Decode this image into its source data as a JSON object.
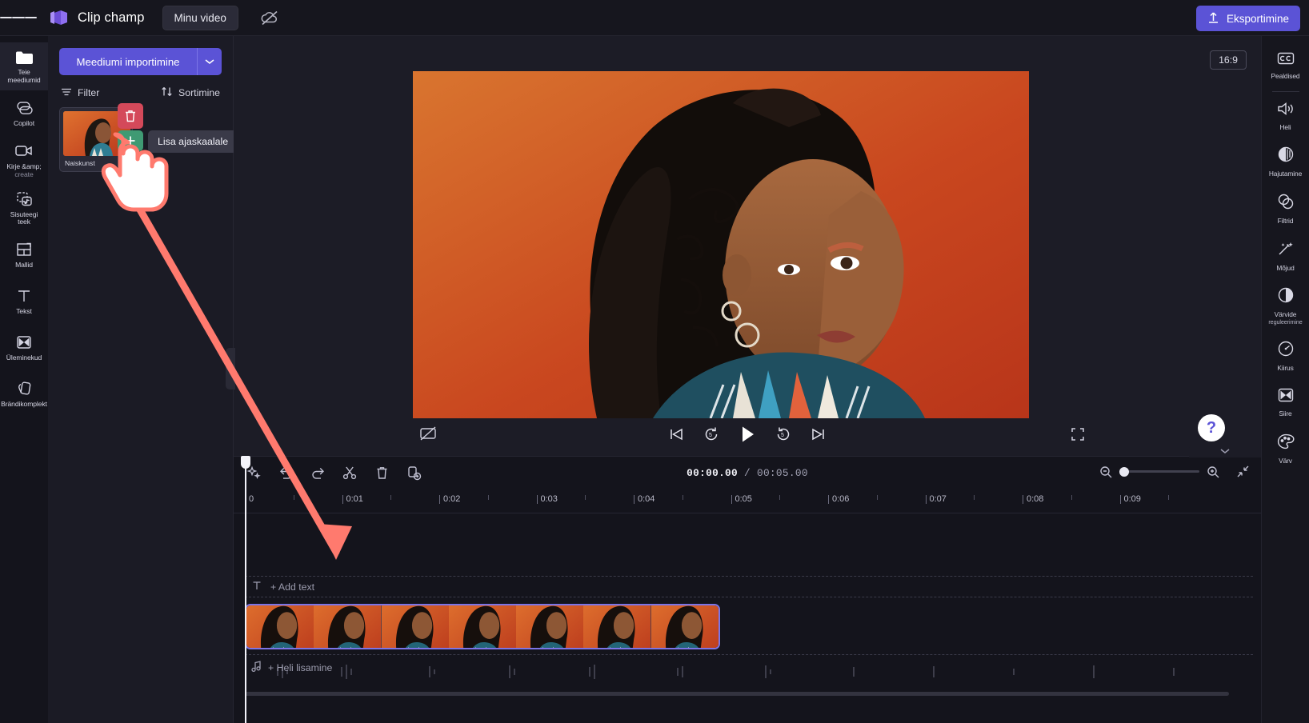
{
  "app": {
    "brand": "Clip champ",
    "project_button": "Minu video",
    "export_button": "Eksportimine",
    "cloud_icon": "cloud-off-icon",
    "menu_icon": "hamburger-icon"
  },
  "left_rail": {
    "items": [
      {
        "label": "Teie meediumid",
        "icon": "folder-icon",
        "active": true
      },
      {
        "label": "Copilot",
        "icon": "copilot-icon",
        "active": false
      },
      {
        "label": "Kirje &amp;",
        "label2": "create",
        "icon": "camera-icon",
        "active": false
      },
      {
        "label": "Sisuteegi",
        "label2": "teek",
        "icon": "content-library-icon",
        "active": false
      },
      {
        "label": "Mallid",
        "icon": "templates-icon",
        "active": false
      },
      {
        "label": "Tekst",
        "icon": "text-icon",
        "active": false
      },
      {
        "label": "Üleminekud",
        "icon": "transitions-icon",
        "active": false
      },
      {
        "label": "Brändikomplekt",
        "icon": "brand-kit-icon",
        "active": false
      }
    ]
  },
  "media_panel": {
    "import_button": "Meediumi importimine",
    "import_caret_icon": "chevron-down-icon",
    "filter_label": "Filter",
    "filter_icon": "filter-icon",
    "sort_label": "Sortimine",
    "sort_icon": "sort-arrows-icon",
    "items": [
      {
        "name": "Naiskunst",
        "delete_icon": "trash-icon",
        "add_icon": "plus-icon"
      }
    ],
    "tooltip": "Lisa ajaskaalale"
  },
  "preview": {
    "aspect_ratio": "16:9",
    "hide_captions_icon": "captions-off-icon",
    "controls": [
      {
        "name": "skip-start-button",
        "icon": "skip-start-icon"
      },
      {
        "name": "rewind-button",
        "icon": "rewind-5-icon"
      },
      {
        "name": "play-button",
        "icon": "play-icon"
      },
      {
        "name": "forward-button",
        "icon": "forward-5-icon"
      },
      {
        "name": "skip-end-button",
        "icon": "skip-end-icon"
      }
    ],
    "fullscreen_icon": "fullscreen-icon",
    "help_label": "?",
    "collapse_icon": "chevron-left-icon"
  },
  "right_rail": {
    "items": [
      {
        "label": "Pealdised",
        "icon": "closed-captions-icon",
        "separator_after": true
      },
      {
        "label": "Heli",
        "icon": "speaker-icon"
      },
      {
        "label": "Hajutamine",
        "icon": "fade-icon"
      },
      {
        "label": "Filtrid",
        "icon": "filters-icon"
      },
      {
        "label": "Mõjud",
        "icon": "effects-wand-icon"
      },
      {
        "label": "Värvide",
        "sub": "reguleerimine",
        "icon": "color-adjust-icon"
      },
      {
        "label": "Kiirus",
        "icon": "speed-gauge-icon"
      },
      {
        "label": "Siire",
        "icon": "transition-icon"
      },
      {
        "label": "Värv",
        "icon": "palette-icon"
      }
    ]
  },
  "timeline": {
    "tools": [
      {
        "name": "magic-button",
        "icon": "sparkle-icon"
      },
      {
        "name": "undo-button",
        "icon": "undo-icon"
      },
      {
        "name": "redo-button",
        "icon": "redo-icon"
      },
      {
        "name": "split-button",
        "icon": "scissors-icon"
      },
      {
        "name": "delete-button",
        "icon": "trash-icon"
      },
      {
        "name": "duplicate-button",
        "icon": "duplicate-icon"
      }
    ],
    "current_time": "00:00.00",
    "time_separator": " / ",
    "total_time": "00:05.00",
    "zoom_out_icon": "zoom-out-icon",
    "zoom_in_icon": "zoom-in-icon",
    "fit_icon": "fit-timeline-icon",
    "collapse_icon": "chevron-down-icon",
    "zoom_value": 0,
    "ruler_ticks": [
      "0",
      "0:01",
      "0:02",
      "0:03",
      "0:04",
      "0:05",
      "0:06",
      "0:07",
      "0:08",
      "0:09"
    ],
    "text_track": {
      "label": "+ Add text",
      "icon": "text-T-icon"
    },
    "audio_track": {
      "label": "+ Heli lisamine",
      "icon": "music-note-icon"
    },
    "video_clip_frames": 7
  },
  "colors": {
    "accent": "#5b53d6",
    "panel_bg": "#1b1b25",
    "app_bg": "#16161e",
    "timeline_bg": "#14141c",
    "delete_red": "#d4495a",
    "add_green": "#3f9a73",
    "cursor_pink": "#ff7a6e",
    "clip_border": "#7b74e6"
  }
}
